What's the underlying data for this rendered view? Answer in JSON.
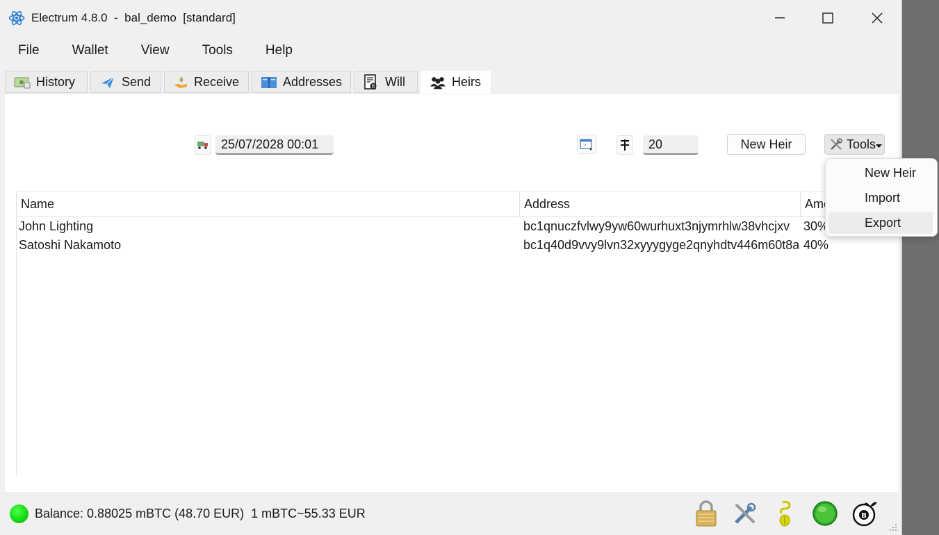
{
  "window": {
    "title": "Electrum 4.8.0  -  bal_demo  [standard]"
  },
  "menu": [
    "File",
    "Wallet",
    "View",
    "Tools",
    "Help"
  ],
  "tabs": [
    {
      "label": "History",
      "icon": "history-icon"
    },
    {
      "label": "Send",
      "icon": "send-icon"
    },
    {
      "label": "Receive",
      "icon": "receive-icon"
    },
    {
      "label": "Addresses",
      "icon": "addresses-icon"
    },
    {
      "label": "Will",
      "icon": "will-icon"
    },
    {
      "label": "Heirs",
      "icon": "heirs-icon",
      "active": true
    }
  ],
  "heirs_toolbar": {
    "locktime": "25/07/2028 00:01",
    "threshold": "20",
    "new_heir_label": "New Heir",
    "tools_label": "Tools"
  },
  "table": {
    "columns": [
      "Name",
      "Address",
      "Amo"
    ],
    "rows": [
      {
        "name": "John Lighting",
        "address": "bc1qnuczfvlwy9yw60wurhuxt3njymrhlw38vhcjxv",
        "amount": "30%"
      },
      {
        "name": "Satoshi Nakamoto",
        "address": "bc1q40d9vvy9lvn32xyyygyge2qnyhdtv446m60t8a",
        "amount": "40%"
      }
    ]
  },
  "tools_menu": {
    "items": [
      "New Heir",
      "Import",
      "Export"
    ],
    "highlighted": "Export"
  },
  "status": {
    "text": "Balance: 0.88025 mBTC (48.70 EUR)  1 mBTC~55.33 EUR",
    "indicator_color": "#1ed41e"
  },
  "colors": {
    "accent": "#2f7fd8",
    "online": "#1ed41e"
  }
}
